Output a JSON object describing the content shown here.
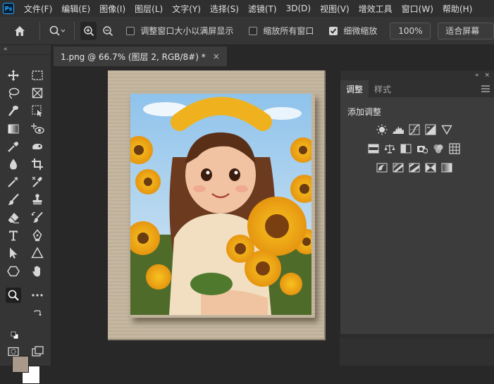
{
  "app": {
    "logo_text": "Ps"
  },
  "menu": [
    {
      "label": "文件(F)"
    },
    {
      "label": "编辑(E)"
    },
    {
      "label": "图像(I)"
    },
    {
      "label": "图层(L)"
    },
    {
      "label": "文字(Y)"
    },
    {
      "label": "选择(S)"
    },
    {
      "label": "滤镜(T)"
    },
    {
      "label": "3D(D)"
    },
    {
      "label": "视图(V)"
    },
    {
      "label": "增效工具"
    },
    {
      "label": "窗口(W)"
    },
    {
      "label": "帮助(H)"
    }
  ],
  "options": {
    "resize_windows_label": "调整窗口大小以满屏显示",
    "resize_windows_checked": false,
    "zoom_all_label": "缩放所有窗口",
    "zoom_all_checked": false,
    "scrubby_zoom_label": "细微缩放",
    "scrubby_zoom_checked": true,
    "zoom_100_label": "100%",
    "fit_screen_label": "适合屏幕"
  },
  "document": {
    "tab_title": "1.png @ 66.7% (图层 2, RGB/8#) *",
    "close_glyph": "×"
  },
  "toolbar": {
    "collapse_glyph": "«"
  },
  "panel": {
    "tabs": [
      {
        "label": "调整",
        "active": true
      },
      {
        "label": "样式",
        "active": false
      }
    ],
    "title": "添加调整",
    "collapse_glyph": "«",
    "close_glyph": "×"
  },
  "colors": {
    "foreground": "#a8998a",
    "background": "#ffffff",
    "accent": "#31a8ff"
  }
}
